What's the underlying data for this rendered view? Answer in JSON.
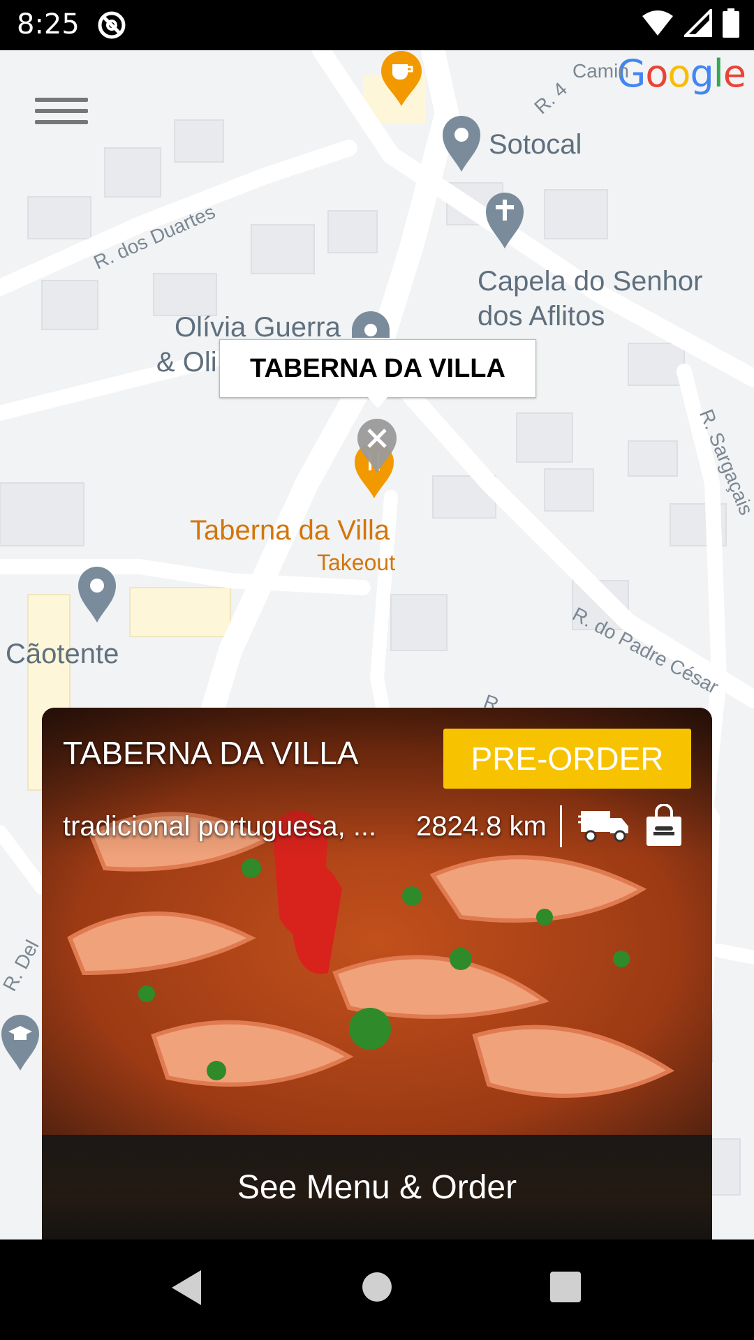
{
  "status_bar": {
    "time": "8:25"
  },
  "map": {
    "google_logo": [
      "G",
      "o",
      "o",
      "g",
      "l",
      "e"
    ],
    "places": {
      "sotocal": "Sotocal",
      "capela_line1": "Capela do Senhor",
      "capela_line2": "dos Aflitos",
      "olivia_line1": "Olívia Guerra",
      "olivia_line2": "& Oli",
      "caotente": "Cãotente",
      "taberna": "Taberna da Villa",
      "taberna_sub": "Takeout"
    },
    "streets": {
      "duartes": "R. dos Duartes",
      "sargacais": "R. Sargaçais",
      "padre_cesar": "R. do Padre César",
      "camin": "Camin",
      "r4": "R. 4",
      "r_del": "R. Del",
      "r_small": "R"
    },
    "info_window_title": "TABERNA DA VILLA"
  },
  "card": {
    "title": "TABERNA DA VILLA",
    "preorder_label": "PRE-ORDER",
    "cuisine": "tradicional portuguesa, ...",
    "distance": "2824.8 km",
    "see_menu_label": "See Menu & Order"
  },
  "colors": {
    "accent_yellow": "#f7c300",
    "place_orange": "#d2760c",
    "pin_gray": "#7a8c9c"
  }
}
